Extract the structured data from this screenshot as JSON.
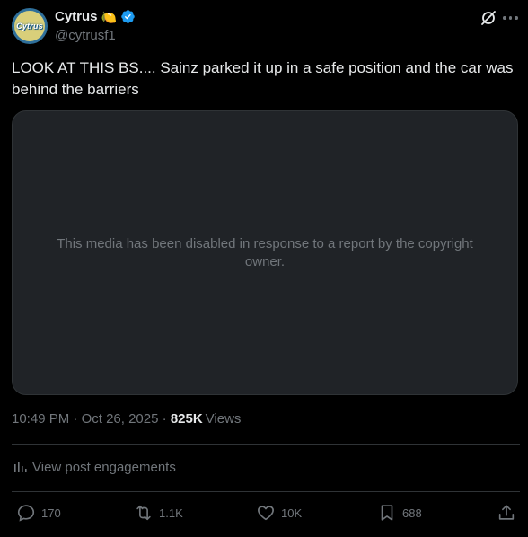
{
  "author": {
    "display_name": "Cytrus",
    "emoji": "🍋",
    "handle": "@cytrusf1",
    "avatar_text": "Cytrus"
  },
  "tweet": {
    "text": "LOOK AT THIS BS.... Sainz parked it up in a safe position and the car was behind the barriers"
  },
  "media": {
    "disabled_message": "This media has been disabled in response to a report by the copyright owner."
  },
  "meta": {
    "time": "10:49 PM",
    "separator": " · ",
    "date": "Oct 26, 2025",
    "separator2": " · ",
    "views_count": "825K",
    "views_label": "Views"
  },
  "engagements": {
    "label": "View post engagements"
  },
  "actions": {
    "replies": "170",
    "reposts": "1.1K",
    "likes": "10K",
    "bookmarks": "688"
  },
  "colors": {
    "background": "#000000",
    "text": "#e7e9ea",
    "secondary": "#71767b",
    "verified": "#1d9bf0",
    "media_bg": "#202327"
  },
  "icons": [
    "grok-icon",
    "more-icon",
    "verified-icon",
    "analytics-icon",
    "reply-icon",
    "repost-icon",
    "like-icon",
    "bookmark-icon",
    "share-icon"
  ]
}
